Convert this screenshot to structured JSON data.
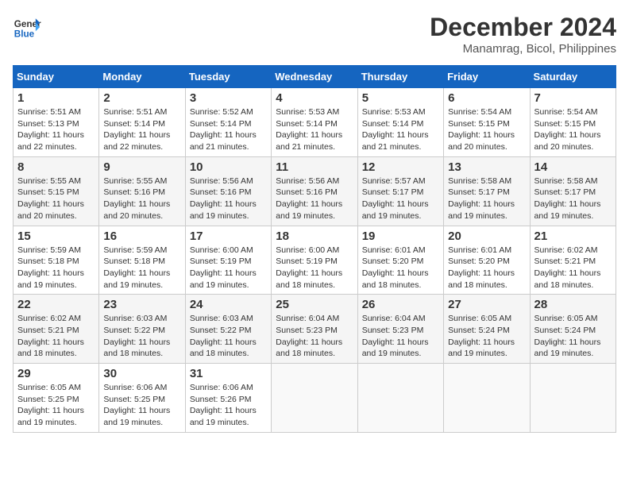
{
  "header": {
    "logo_line1": "General",
    "logo_line2": "Blue",
    "month": "December 2024",
    "location": "Manamrag, Bicol, Philippines"
  },
  "days_of_week": [
    "Sunday",
    "Monday",
    "Tuesday",
    "Wednesday",
    "Thursday",
    "Friday",
    "Saturday"
  ],
  "weeks": [
    [
      {
        "day": "1",
        "info": "Sunrise: 5:51 AM\nSunset: 5:13 PM\nDaylight: 11 hours\nand 22 minutes."
      },
      {
        "day": "2",
        "info": "Sunrise: 5:51 AM\nSunset: 5:14 PM\nDaylight: 11 hours\nand 22 minutes."
      },
      {
        "day": "3",
        "info": "Sunrise: 5:52 AM\nSunset: 5:14 PM\nDaylight: 11 hours\nand 21 minutes."
      },
      {
        "day": "4",
        "info": "Sunrise: 5:53 AM\nSunset: 5:14 PM\nDaylight: 11 hours\nand 21 minutes."
      },
      {
        "day": "5",
        "info": "Sunrise: 5:53 AM\nSunset: 5:14 PM\nDaylight: 11 hours\nand 21 minutes."
      },
      {
        "day": "6",
        "info": "Sunrise: 5:54 AM\nSunset: 5:15 PM\nDaylight: 11 hours\nand 20 minutes."
      },
      {
        "day": "7",
        "info": "Sunrise: 5:54 AM\nSunset: 5:15 PM\nDaylight: 11 hours\nand 20 minutes."
      }
    ],
    [
      {
        "day": "8",
        "info": "Sunrise: 5:55 AM\nSunset: 5:15 PM\nDaylight: 11 hours\nand 20 minutes."
      },
      {
        "day": "9",
        "info": "Sunrise: 5:55 AM\nSunset: 5:16 PM\nDaylight: 11 hours\nand 20 minutes."
      },
      {
        "day": "10",
        "info": "Sunrise: 5:56 AM\nSunset: 5:16 PM\nDaylight: 11 hours\nand 19 minutes."
      },
      {
        "day": "11",
        "info": "Sunrise: 5:56 AM\nSunset: 5:16 PM\nDaylight: 11 hours\nand 19 minutes."
      },
      {
        "day": "12",
        "info": "Sunrise: 5:57 AM\nSunset: 5:17 PM\nDaylight: 11 hours\nand 19 minutes."
      },
      {
        "day": "13",
        "info": "Sunrise: 5:58 AM\nSunset: 5:17 PM\nDaylight: 11 hours\nand 19 minutes."
      },
      {
        "day": "14",
        "info": "Sunrise: 5:58 AM\nSunset: 5:17 PM\nDaylight: 11 hours\nand 19 minutes."
      }
    ],
    [
      {
        "day": "15",
        "info": "Sunrise: 5:59 AM\nSunset: 5:18 PM\nDaylight: 11 hours\nand 19 minutes."
      },
      {
        "day": "16",
        "info": "Sunrise: 5:59 AM\nSunset: 5:18 PM\nDaylight: 11 hours\nand 19 minutes."
      },
      {
        "day": "17",
        "info": "Sunrise: 6:00 AM\nSunset: 5:19 PM\nDaylight: 11 hours\nand 19 minutes."
      },
      {
        "day": "18",
        "info": "Sunrise: 6:00 AM\nSunset: 5:19 PM\nDaylight: 11 hours\nand 18 minutes."
      },
      {
        "day": "19",
        "info": "Sunrise: 6:01 AM\nSunset: 5:20 PM\nDaylight: 11 hours\nand 18 minutes."
      },
      {
        "day": "20",
        "info": "Sunrise: 6:01 AM\nSunset: 5:20 PM\nDaylight: 11 hours\nand 18 minutes."
      },
      {
        "day": "21",
        "info": "Sunrise: 6:02 AM\nSunset: 5:21 PM\nDaylight: 11 hours\nand 18 minutes."
      }
    ],
    [
      {
        "day": "22",
        "info": "Sunrise: 6:02 AM\nSunset: 5:21 PM\nDaylight: 11 hours\nand 18 minutes."
      },
      {
        "day": "23",
        "info": "Sunrise: 6:03 AM\nSunset: 5:22 PM\nDaylight: 11 hours\nand 18 minutes."
      },
      {
        "day": "24",
        "info": "Sunrise: 6:03 AM\nSunset: 5:22 PM\nDaylight: 11 hours\nand 18 minutes."
      },
      {
        "day": "25",
        "info": "Sunrise: 6:04 AM\nSunset: 5:23 PM\nDaylight: 11 hours\nand 18 minutes."
      },
      {
        "day": "26",
        "info": "Sunrise: 6:04 AM\nSunset: 5:23 PM\nDaylight: 11 hours\nand 19 minutes."
      },
      {
        "day": "27",
        "info": "Sunrise: 6:05 AM\nSunset: 5:24 PM\nDaylight: 11 hours\nand 19 minutes."
      },
      {
        "day": "28",
        "info": "Sunrise: 6:05 AM\nSunset: 5:24 PM\nDaylight: 11 hours\nand 19 minutes."
      }
    ],
    [
      {
        "day": "29",
        "info": "Sunrise: 6:05 AM\nSunset: 5:25 PM\nDaylight: 11 hours\nand 19 minutes."
      },
      {
        "day": "30",
        "info": "Sunrise: 6:06 AM\nSunset: 5:25 PM\nDaylight: 11 hours\nand 19 minutes."
      },
      {
        "day": "31",
        "info": "Sunrise: 6:06 AM\nSunset: 5:26 PM\nDaylight: 11 hours\nand 19 minutes."
      },
      null,
      null,
      null,
      null
    ]
  ]
}
